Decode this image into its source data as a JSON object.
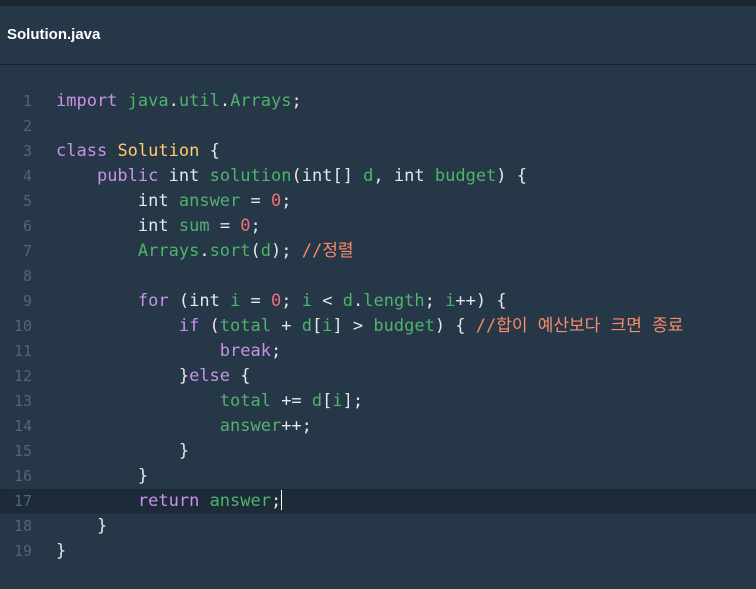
{
  "tab": {
    "title": "Solution.java"
  },
  "editor": {
    "active_line": 17,
    "lines": [
      {
        "n": "1",
        "t": [
          [
            "kw",
            "import"
          ],
          [
            "pn",
            " "
          ],
          [
            "fn",
            "java"
          ],
          [
            "pn",
            "."
          ],
          [
            "fn",
            "util"
          ],
          [
            "pn",
            "."
          ],
          [
            "fn",
            "Arrays"
          ],
          [
            "pn",
            ";"
          ]
        ]
      },
      {
        "n": "2",
        "t": []
      },
      {
        "n": "3",
        "t": [
          [
            "kw",
            "class"
          ],
          [
            "pn",
            " "
          ],
          [
            "cl",
            "Solution"
          ],
          [
            "pn",
            " {"
          ]
        ]
      },
      {
        "n": "4",
        "t": [
          [
            "pn",
            "    "
          ],
          [
            "kw",
            "public"
          ],
          [
            "pn",
            " "
          ],
          [
            "ty",
            "int"
          ],
          [
            "pn",
            " "
          ],
          [
            "fn",
            "solution"
          ],
          [
            "pn",
            "("
          ],
          [
            "ty",
            "int"
          ],
          [
            "pn",
            "[] "
          ],
          [
            "vr",
            "d"
          ],
          [
            "pn",
            ", "
          ],
          [
            "ty",
            "int"
          ],
          [
            "pn",
            " "
          ],
          [
            "vr",
            "budget"
          ],
          [
            "pn",
            ") {"
          ]
        ]
      },
      {
        "n": "5",
        "t": [
          [
            "pn",
            "        "
          ],
          [
            "ty",
            "int"
          ],
          [
            "pn",
            " "
          ],
          [
            "vr",
            "answer"
          ],
          [
            "pn",
            " = "
          ],
          [
            "nm",
            "0"
          ],
          [
            "pn",
            ";"
          ]
        ]
      },
      {
        "n": "6",
        "t": [
          [
            "pn",
            "        "
          ],
          [
            "ty",
            "int"
          ],
          [
            "pn",
            " "
          ],
          [
            "vr",
            "sum"
          ],
          [
            "pn",
            " = "
          ],
          [
            "nm",
            "0"
          ],
          [
            "pn",
            ";"
          ]
        ]
      },
      {
        "n": "7",
        "t": [
          [
            "pn",
            "        "
          ],
          [
            "fn",
            "Arrays"
          ],
          [
            "pn",
            "."
          ],
          [
            "fn",
            "sort"
          ],
          [
            "pn",
            "("
          ],
          [
            "vr",
            "d"
          ],
          [
            "pn",
            "); "
          ],
          [
            "cm",
            "//정렬"
          ]
        ]
      },
      {
        "n": "8",
        "t": []
      },
      {
        "n": "9",
        "t": [
          [
            "pn",
            "        "
          ],
          [
            "kw",
            "for"
          ],
          [
            "pn",
            " ("
          ],
          [
            "ty",
            "int"
          ],
          [
            "pn",
            " "
          ],
          [
            "vr",
            "i"
          ],
          [
            "pn",
            " = "
          ],
          [
            "nm",
            "0"
          ],
          [
            "pn",
            "; "
          ],
          [
            "vr",
            "i"
          ],
          [
            "pn",
            " < "
          ],
          [
            "vr",
            "d"
          ],
          [
            "pn",
            "."
          ],
          [
            "fn",
            "length"
          ],
          [
            "pn",
            "; "
          ],
          [
            "vr",
            "i"
          ],
          [
            "pn",
            "++) {"
          ]
        ]
      },
      {
        "n": "10",
        "t": [
          [
            "pn",
            "            "
          ],
          [
            "kw",
            "if"
          ],
          [
            "pn",
            " ("
          ],
          [
            "vr",
            "total"
          ],
          [
            "pn",
            " + "
          ],
          [
            "vr",
            "d"
          ],
          [
            "pn",
            "["
          ],
          [
            "vr",
            "i"
          ],
          [
            "pn",
            "] > "
          ],
          [
            "vr",
            "budget"
          ],
          [
            "pn",
            ") { "
          ],
          [
            "cm",
            "//합이 예산보다 크면 종료"
          ]
        ]
      },
      {
        "n": "11",
        "t": [
          [
            "pn",
            "                "
          ],
          [
            "kw",
            "break"
          ],
          [
            "pn",
            ";"
          ]
        ]
      },
      {
        "n": "12",
        "t": [
          [
            "pn",
            "            }"
          ],
          [
            "kw",
            "else"
          ],
          [
            "pn",
            " {"
          ]
        ]
      },
      {
        "n": "13",
        "t": [
          [
            "pn",
            "                "
          ],
          [
            "vr",
            "total"
          ],
          [
            "pn",
            " += "
          ],
          [
            "vr",
            "d"
          ],
          [
            "pn",
            "["
          ],
          [
            "vr",
            "i"
          ],
          [
            "pn",
            "];"
          ]
        ]
      },
      {
        "n": "14",
        "t": [
          [
            "pn",
            "                "
          ],
          [
            "vr",
            "answer"
          ],
          [
            "pn",
            "++;"
          ]
        ]
      },
      {
        "n": "15",
        "t": [
          [
            "pn",
            "            }"
          ]
        ]
      },
      {
        "n": "16",
        "t": [
          [
            "pn",
            "        }"
          ]
        ]
      },
      {
        "n": "17",
        "t": [
          [
            "pn",
            "        "
          ],
          [
            "kw",
            "return"
          ],
          [
            "pn",
            " "
          ],
          [
            "vr",
            "answer"
          ],
          [
            "pn",
            ";"
          ]
        ]
      },
      {
        "n": "18",
        "t": [
          [
            "pn",
            "    }"
          ]
        ]
      },
      {
        "n": "19",
        "t": [
          [
            "pn",
            "}"
          ]
        ]
      }
    ]
  }
}
